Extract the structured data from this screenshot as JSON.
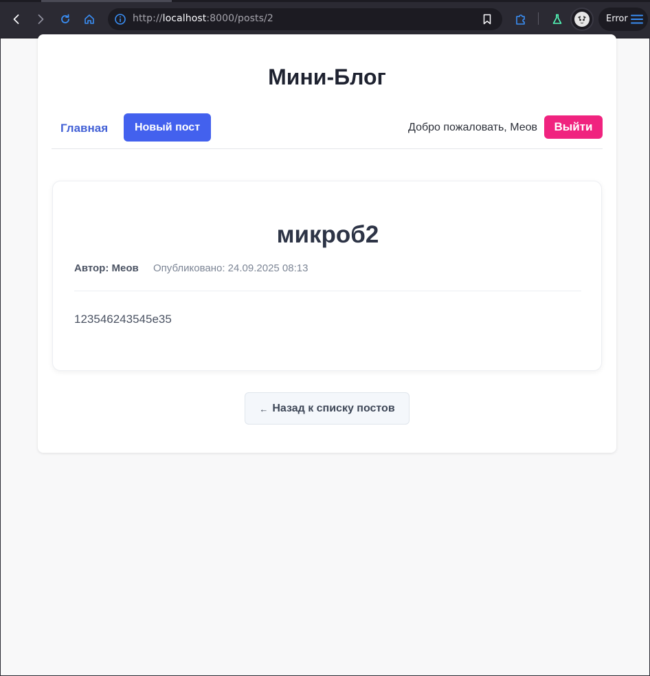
{
  "browser": {
    "url_prefix": "http://",
    "url_host": "localhost",
    "url_rest": ":8000/posts/2",
    "error_label": "Error",
    "icons": [
      "back-icon",
      "forward-icon",
      "reload-icon",
      "home-icon",
      "info-icon",
      "bookmark-icon",
      "extensions-icon",
      "labs-flask-icon",
      "profile-avatar",
      "menu-icon"
    ]
  },
  "site": {
    "title": "Мини-Блог"
  },
  "nav": {
    "home_label": "Главная",
    "new_post_label": "Новый пост",
    "welcome_text": "Добро пожаловать, Меов",
    "logout_label": "Выйти"
  },
  "post": {
    "title": "микроб2",
    "author": "Автор: Меов",
    "published": "Опубликовано: 24.09.2025 08:13",
    "body": "123546243545e35"
  },
  "actions": {
    "back_arrow": "←",
    "back_label": "Назад к списку постов"
  },
  "colors": {
    "primary": "#4361ee",
    "logout": "#f0237f",
    "title": "#1e2230",
    "chrome_bg": "#2b2a33"
  }
}
